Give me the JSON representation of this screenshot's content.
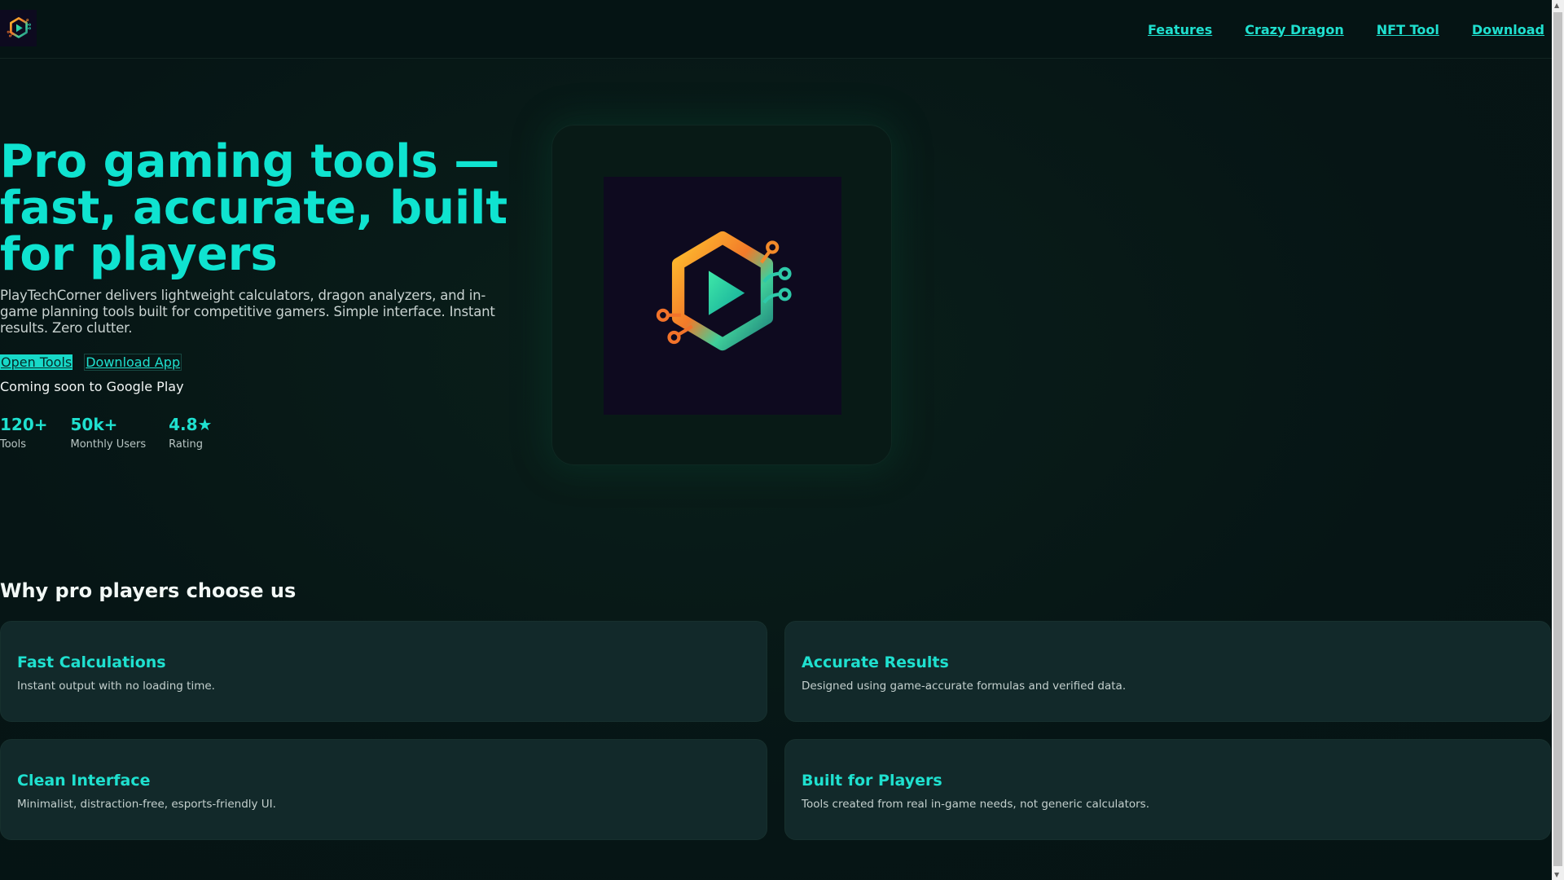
{
  "header": {
    "logo_alt": "PlayTechCorner logo",
    "nav": [
      {
        "label": "Features"
      },
      {
        "label": "Crazy Dragon"
      },
      {
        "label": "NFT Tool"
      },
      {
        "label": "Download"
      }
    ]
  },
  "hero": {
    "title": "Pro gaming tools — fast, accurate, built for players",
    "lead": "PlayTechCorner delivers lightweight calculators, dragon analyzers, and in-game planning tools built for competitive gamers. Simple interface. Instant results. Zero clutter.",
    "primary_button": "Open Tools",
    "secondary_button": "Download App",
    "note": "Coming soon to Google Play",
    "stats": [
      {
        "value": "120+",
        "label": "Tools"
      },
      {
        "value": "50k+",
        "label": "Monthly Users"
      },
      {
        "value": "4.8★",
        "label": "Rating"
      }
    ]
  },
  "features": {
    "heading": "Why pro players choose us",
    "items": [
      {
        "title": "Fast Calculations",
        "desc": "Instant output with no loading time."
      },
      {
        "title": "Accurate Results",
        "desc": "Designed using game-accurate formulas and verified data."
      },
      {
        "title": "Clean Interface",
        "desc": "Minimalist, distraction-free, esports-friendly UI."
      },
      {
        "title": "Built for Players",
        "desc": "Tools created from real in-game needs, not generic calculators."
      }
    ]
  },
  "colors": {
    "accent": "#0fe3d0",
    "background": "#061616",
    "card": "#12292a"
  }
}
